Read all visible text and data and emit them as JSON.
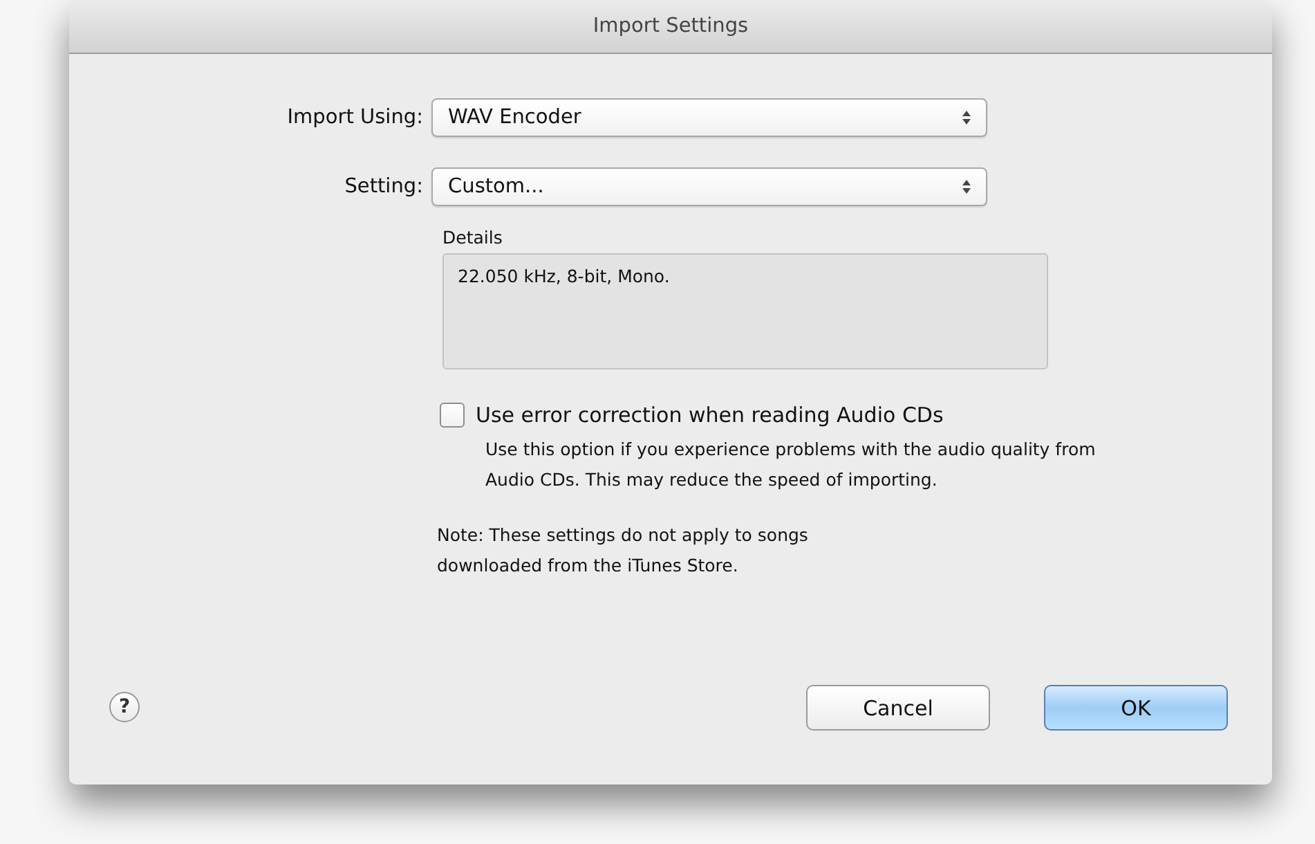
{
  "window": {
    "title": "Import Settings"
  },
  "fields": [
    {
      "label": "Import Using:",
      "value": "WAV Encoder"
    },
    {
      "label": "Setting:",
      "value": "Custom..."
    }
  ],
  "details": {
    "label": "Details",
    "text": "22.050 kHz, 8-bit, Mono."
  },
  "error_correction": {
    "label": "Use error correction when reading Audio CDs",
    "checked": false,
    "description": "Use this option if you experience problems with the audio quality from Audio CDs.  This may reduce the speed of importing."
  },
  "note": "Note: These settings do not apply to songs downloaded from the iTunes Store.",
  "help": {
    "symbol": "?"
  },
  "buttons": [
    {
      "label": "Cancel",
      "kind": "normal"
    },
    {
      "label": "OK",
      "kind": "default"
    }
  ]
}
